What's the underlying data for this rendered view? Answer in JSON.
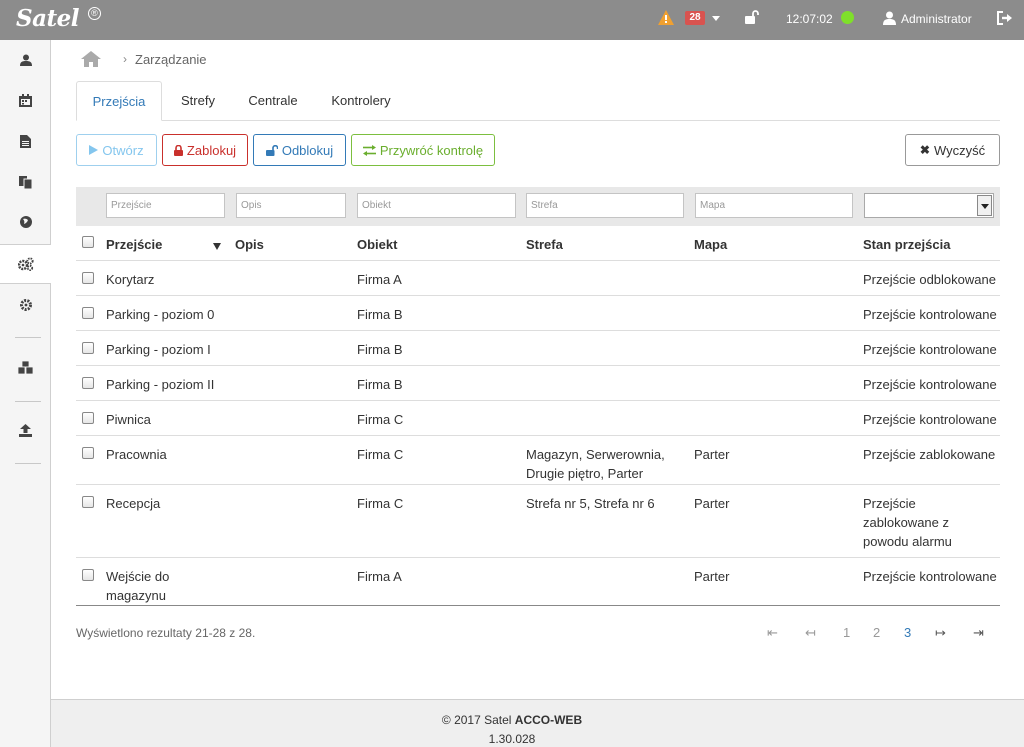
{
  "header": {
    "logo": "Satel",
    "logo_badge": "®",
    "alarm_count": "28",
    "time": "12:07:02",
    "user": "Administrator"
  },
  "breadcrumb": {
    "current": "Zarządzanie"
  },
  "tabs": [
    "Przejścia",
    "Strefy",
    "Centrale",
    "Kontrolery"
  ],
  "toolbar": {
    "open": "Otwórz",
    "lock": "Zablokuj",
    "unlock": "Odblokuj",
    "restore": "Przywróć kontrolę",
    "clear": "Wyczyść"
  },
  "filters": {
    "doorway": "Przejście",
    "description": "Opis",
    "object": "Obiekt",
    "zone": "Strefa",
    "map": "Mapa"
  },
  "columns": [
    "Przejście",
    "Opis",
    "Obiekt",
    "Strefa",
    "Mapa",
    "Stan przejścia"
  ],
  "rows": [
    {
      "doorway": "Korytarz",
      "description": "",
      "object": "Firma A",
      "zone": "",
      "map": "",
      "state": "Przejście odblokowane"
    },
    {
      "doorway": "Parking - poziom 0",
      "description": "",
      "object": "Firma B",
      "zone": "",
      "map": "",
      "state": "Przejście kontrolowane"
    },
    {
      "doorway": "Parking - poziom I",
      "description": "",
      "object": "Firma B",
      "zone": "",
      "map": "",
      "state": "Przejście kontrolowane"
    },
    {
      "doorway": "Parking - poziom II",
      "description": "",
      "object": "Firma B",
      "zone": "",
      "map": "",
      "state": "Przejście kontrolowane"
    },
    {
      "doorway": "Piwnica",
      "description": "",
      "object": "Firma C",
      "zone": "",
      "map": "",
      "state": "Przejście kontrolowane"
    },
    {
      "doorway": "Pracownia",
      "description": "",
      "object": "Firma C",
      "zone": "Magazyn, Serwerownia, Drugie piętro, Parter",
      "map": "Parter",
      "state": "Przejście zablokowane"
    },
    {
      "doorway": "Recepcja",
      "description": "",
      "object": "Firma C",
      "zone": "Strefa nr 5, Strefa nr 6",
      "map": "Parter",
      "state": "Przejście zablokowane z powodu alarmu"
    },
    {
      "doorway": "Wejście do magazynu",
      "description": "",
      "object": "Firma A",
      "zone": "",
      "map": "Parter",
      "state": "Przejście kontrolowane"
    }
  ],
  "results": "Wyświetlono rezultaty 21-28 z 28.",
  "pagination": {
    "first": "⇤",
    "prev": "↤",
    "pages": [
      "1",
      "2",
      "3"
    ],
    "current_page": "3",
    "next": "↦",
    "last": "⇥"
  },
  "footer": {
    "copyright_prefix": "© 2017 Satel ",
    "product": "ACCO-WEB",
    "version": "1.30.028"
  },
  "colors": {
    "header_bg": "#8c8c8c",
    "alarm_red": "#d9534f",
    "status_green": "#7fe02a",
    "warning_orange": "#f0a030",
    "link_blue": "#337ab7"
  },
  "icons": {
    "sidebar": [
      "user-icon",
      "calendar-icon",
      "document-icon",
      "copy-icon",
      "globe-icon",
      "cogs-icon",
      "gear-icon",
      "cubes-icon",
      "upload-icon"
    ],
    "active_sidebar": "cogs-icon"
  }
}
